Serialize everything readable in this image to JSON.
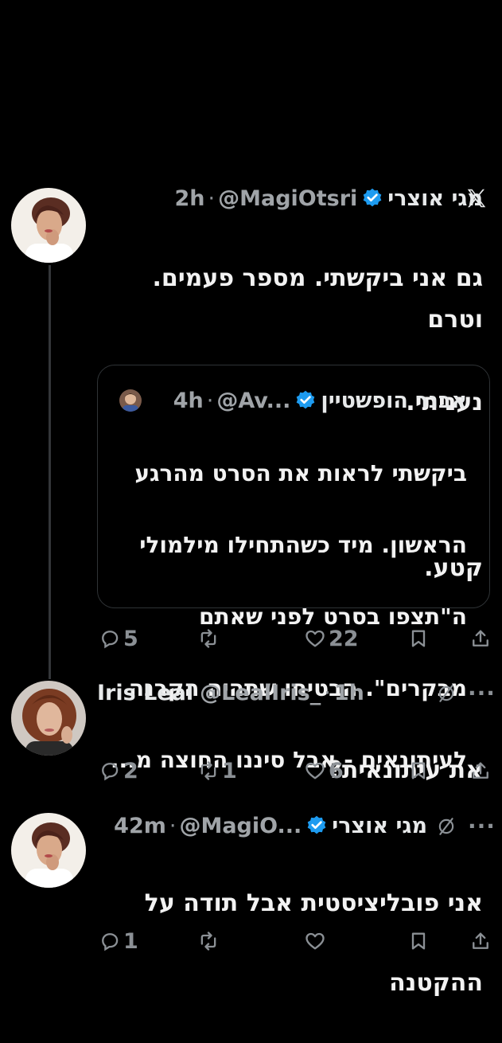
{
  "tweets": [
    {
      "author": "מגי אוצרי",
      "handle": "@MagiOtsri",
      "time": "2h",
      "text_lines": [
        "גם אני ביקשתי. מספר פעמים. וטרם",
        "נעניתי.",
        "",
        "קטע."
      ],
      "quote": {
        "author": "אבנר הופשטיין",
        "handle": "@Av...",
        "time": "4h",
        "text_lines": [
          "ביקשתי לראות את הסרט מהרגע",
          "הראשון. מיד כשהתחילו מילמולי",
          "ה\"תצפו בסרט לפני שאתם",
          "מבקרים\". הבטיחו שתהיה הקרנה",
          "לעיתונאים - אבל סיננו החוצה מ..."
        ]
      },
      "stats": {
        "replies": "5",
        "retweets": "",
        "likes": "22"
      }
    },
    {
      "author": "Iris Leal",
      "handle": "@LealIris_",
      "time": "1h",
      "text_lines": [
        "את עיתונאית?"
      ],
      "stats": {
        "replies": "2",
        "retweets": "1",
        "likes": "6"
      }
    },
    {
      "author": "מגי אוצרי",
      "handle": "@MagiO...",
      "time": "42m",
      "text_lines": [
        "אני פובליציסטית אבל תודה על",
        "ההקטנה"
      ],
      "stats": {
        "replies": "1",
        "retweets": "",
        "likes": ""
      }
    }
  ],
  "separator": "·",
  "colors": {
    "background": "#000000",
    "text": "#e7e9ea",
    "muted": "#71767b",
    "verified": "#1d9bf0",
    "border": "#2f3336"
  },
  "icons": [
    "x-logo-icon",
    "verified-badge-icon",
    "reply-icon",
    "retweet-icon",
    "like-icon",
    "bookmark-icon",
    "share-icon",
    "hide-reply-icon",
    "more-icon"
  ]
}
